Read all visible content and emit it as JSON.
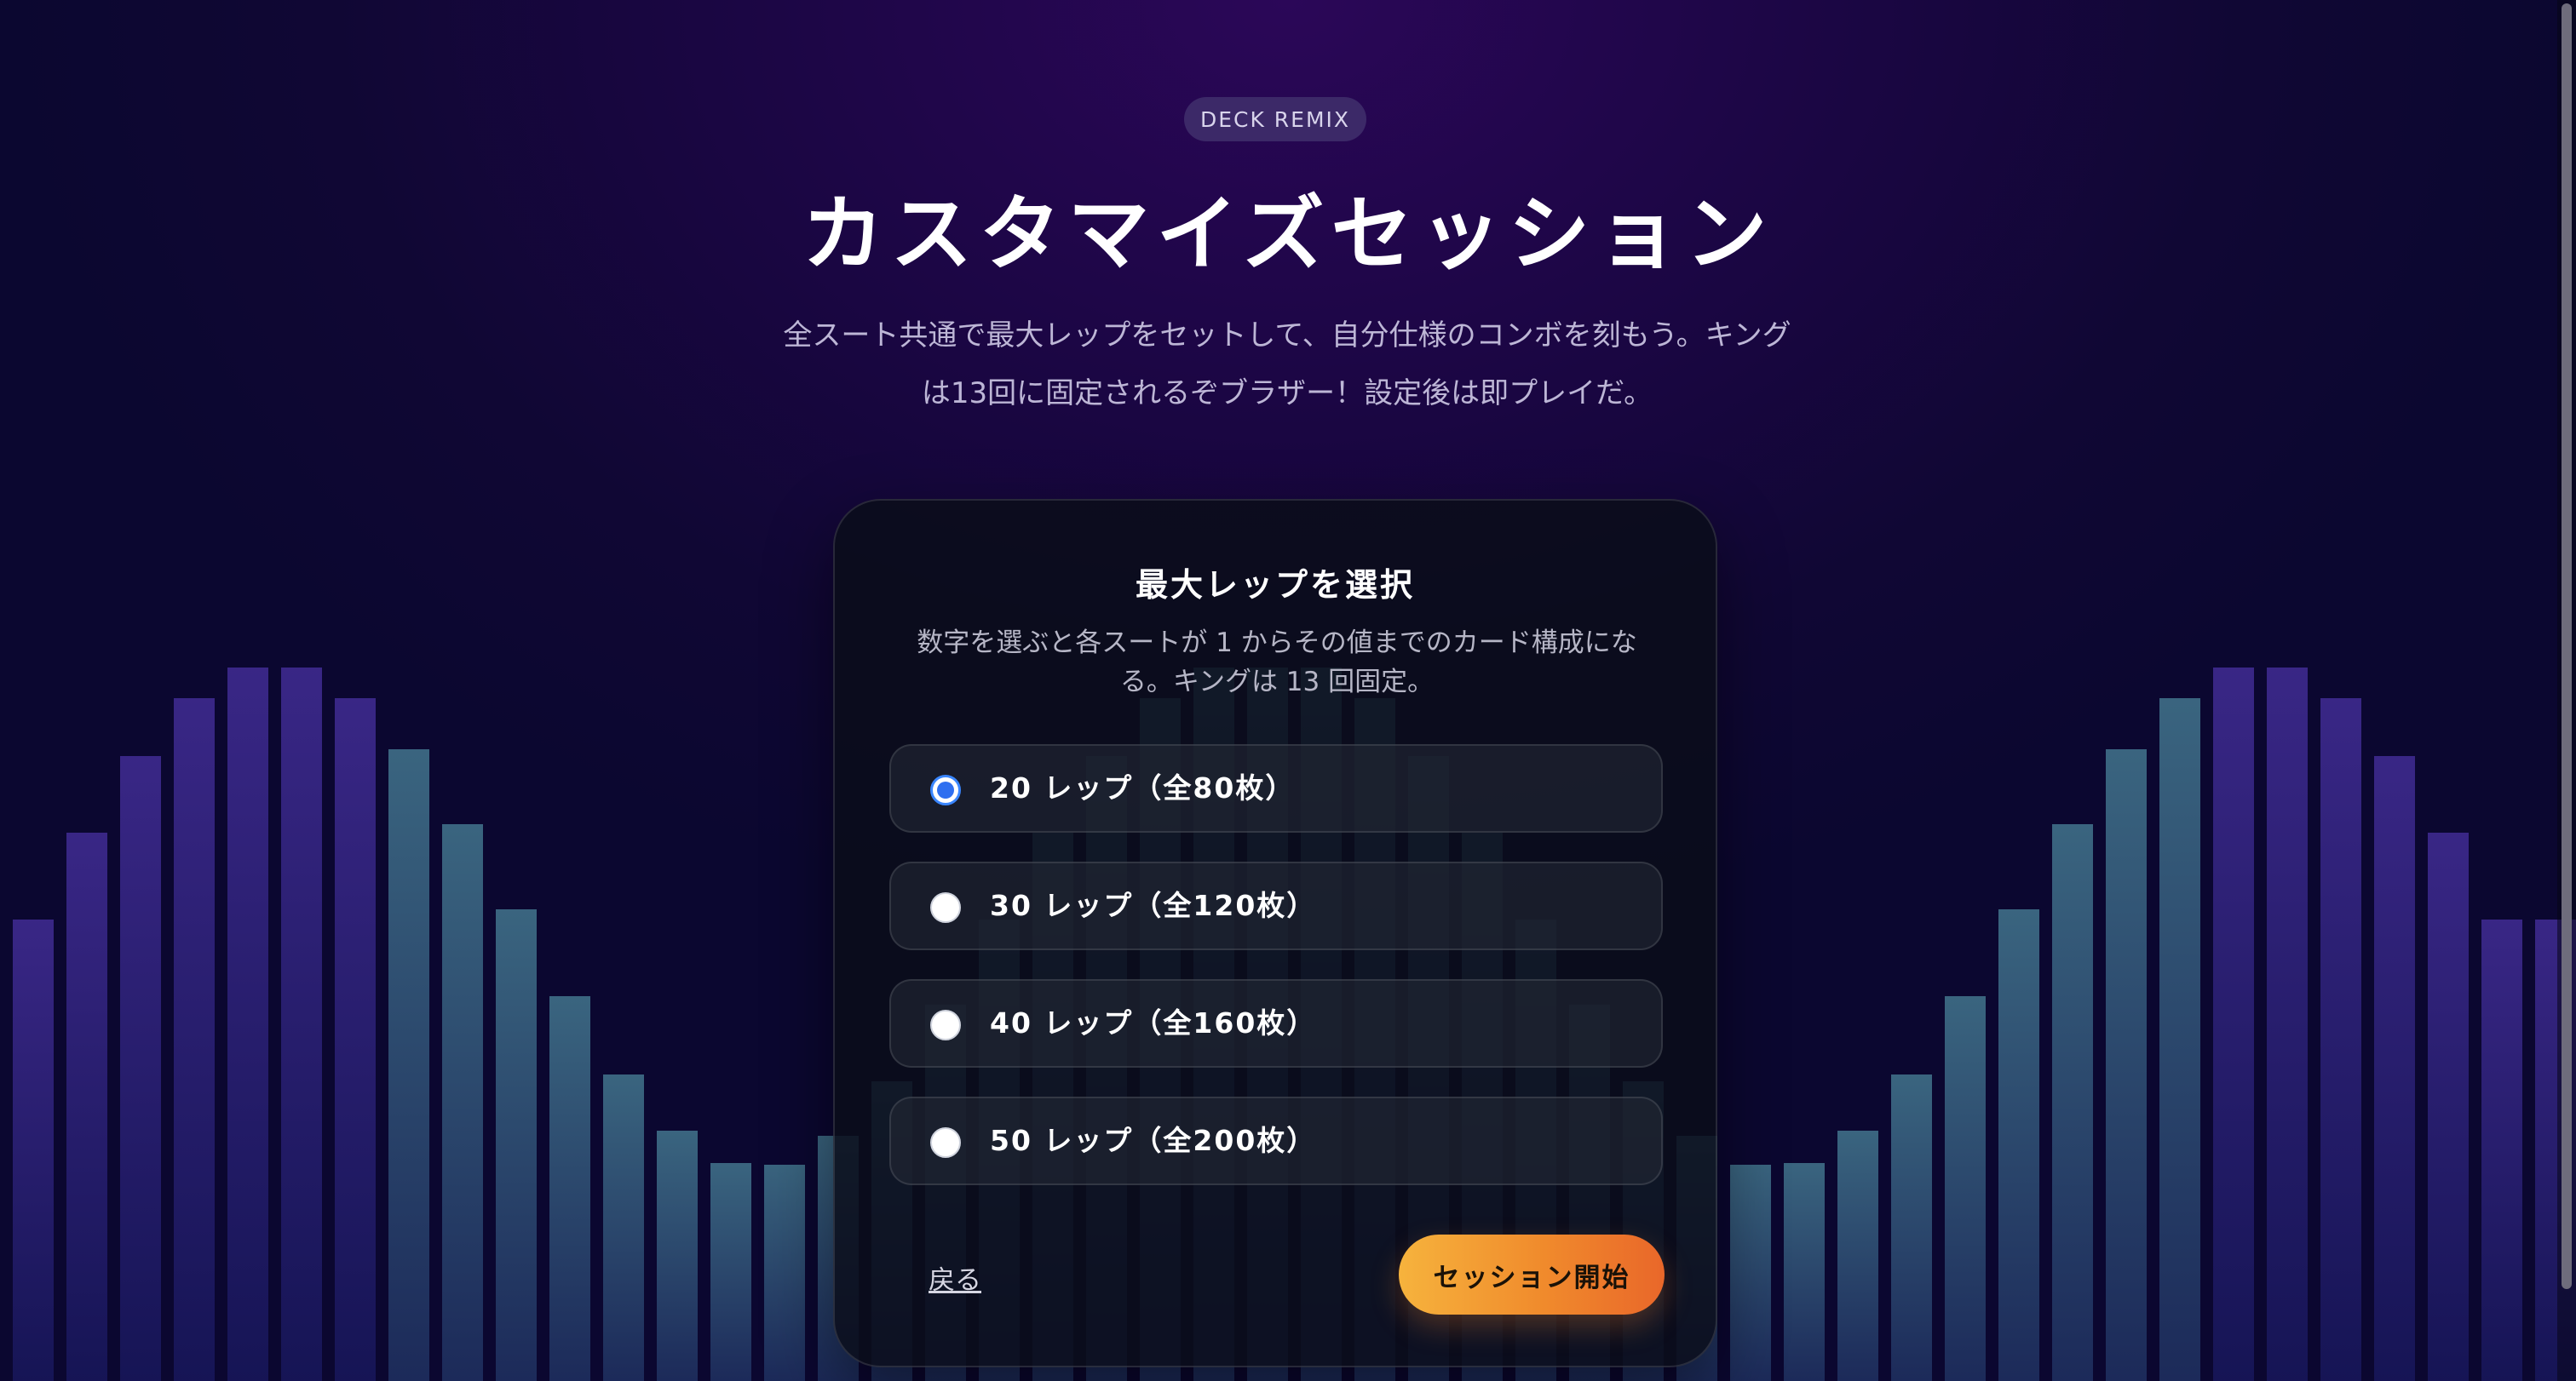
{
  "brand": {
    "badge": "DECK REMIX"
  },
  "header": {
    "title": "カスタマイズセッション",
    "description_line1": "全スート共通で最大レップをセットして、自分仕様のコンボを刻もう。キング",
    "description_line2": "は13回に固定されるぞブラザー！設定後は即プレイだ。"
  },
  "card": {
    "title": "最大レップを選択",
    "description_line1": "数字を選ぶと各スートが 1 からその値までのカード構成にな",
    "description_line2": "る。キングは 13 回固定。",
    "options": [
      {
        "label": "20 レップ（全80枚）",
        "selected": true
      },
      {
        "label": "30 レップ（全120枚）",
        "selected": false
      },
      {
        "label": "40 レップ（全160枚）",
        "selected": false
      },
      {
        "label": "50 レップ（全200枚）",
        "selected": false
      }
    ],
    "back_label": "戻る",
    "start_label": "セッション開始"
  },
  "colors": {
    "accent": "#3a86ff",
    "start_button_from": "#f6b33d",
    "start_button_to": "#e9672a",
    "bar_outer": "#3b2a90",
    "bar_inner": "#3f6f8a"
  }
}
